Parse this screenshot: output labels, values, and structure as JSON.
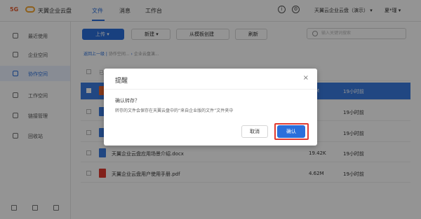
{
  "topbar": {
    "logo_5g": "5G",
    "brand": "天翼企业云盘",
    "tabs": [
      "文件",
      "消息",
      "工作台"
    ],
    "org_name": "天翼云企业云盘（演示）",
    "user_name": "夏*瑾"
  },
  "sidebar": {
    "items": [
      {
        "label": "最近使用",
        "icon": "clock-icon"
      },
      {
        "label": "企业空间",
        "icon": "building-icon"
      },
      {
        "label": "协作空间",
        "icon": "users-icon"
      },
      {
        "label": "工作空间",
        "icon": "folder-icon"
      },
      {
        "label": "链接管理",
        "icon": "link-icon"
      },
      {
        "label": "回收站",
        "icon": "trash-icon"
      }
    ]
  },
  "toolbar": {
    "upload": "上传",
    "new": "新建",
    "from_template": "从模板创建",
    "refresh": "刷新",
    "search_placeholder": "输入关键词搜索"
  },
  "breadcrumb": {
    "back": "返回上一级",
    "path1": "协作空间...",
    "path2": "企业云盘演..."
  },
  "files": {
    "header_hint": "已",
    "rows": [
      {
        "name": "",
        "size": "57M",
        "time": "19小时前",
        "type": "ppt",
        "selected": true
      },
      {
        "name": "",
        "size": "",
        "time": "19小时前",
        "type": "word"
      },
      {
        "name": "",
        "size": "",
        "time": "19小时前",
        "type": "word"
      },
      {
        "name": "天翼企业云盘应用场景介绍.docx",
        "size": "19.42K",
        "time": "19小时前",
        "type": "word"
      },
      {
        "name": "天翼企业云盘用户使用手册.pdf",
        "size": "4.62M",
        "time": "19小时前",
        "type": "pdf"
      }
    ]
  },
  "dialog": {
    "title": "提醒",
    "question": "确认转存？",
    "message": "转存的文件会保存在天翼云盘中的“来自企业版的文件”文件夹中",
    "cancel": "取消",
    "confirm": "确认",
    "close": "×"
  },
  "colors": {
    "accent": "#2a6fdb",
    "highlight": "#e03a2f"
  }
}
